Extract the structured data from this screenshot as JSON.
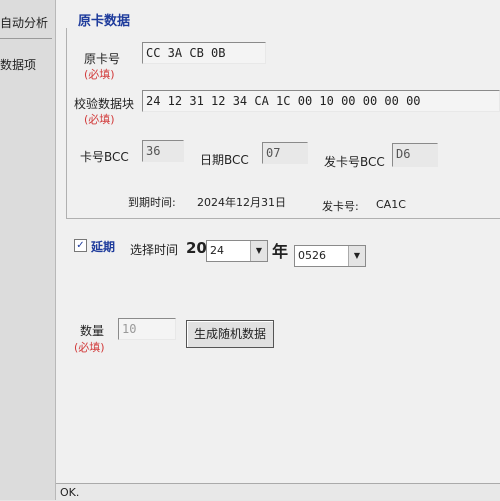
{
  "left": {
    "tab_label": "自动分析",
    "item_label": "数据项"
  },
  "card": {
    "group_title": "原卡数据",
    "card_no": {
      "label": "原卡号",
      "required": "(必填)",
      "value": "CC 3A CB 0B"
    },
    "check_block": {
      "label": "校验数据块",
      "required": "(必填)",
      "value": "24 12 31 12 34 CA 1C 00 10 00 00 00 00"
    },
    "card_bcc": {
      "label": "卡号BCC",
      "value": "36"
    },
    "date_bcc": {
      "label": "日期BCC",
      "value": "07"
    },
    "issuer_bcc": {
      "label": "发卡号BCC",
      "value": "D6"
    },
    "expiry_label": "到期时间:",
    "expiry_value": "2024年12月31日",
    "issuer_label": "发卡号:",
    "issuer_value": "CA1C"
  },
  "extend": {
    "checked": true,
    "check_mark": "✓",
    "label": "延期",
    "time_label": "选择时间",
    "year_prefix": "20",
    "year_value": "24",
    "year_suffix": "年",
    "date_value": "0526"
  },
  "quantity": {
    "label": "数量",
    "required": "(必填)",
    "placeholder": "10"
  },
  "generate_button": "生成随机数据",
  "status_text": "OK.",
  "colors": {
    "accent": "#1f3c9c",
    "required": "#d23b3b"
  }
}
